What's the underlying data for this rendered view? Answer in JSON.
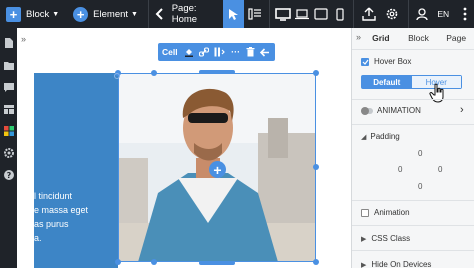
{
  "topbar": {
    "add_label": "Block",
    "element_label": "Element",
    "page_label": "Page: Home",
    "lang": "EN"
  },
  "canvas": {
    "text_lines": [
      "l tincidunt",
      "e massa eget",
      "as purus",
      "a."
    ]
  },
  "toolbar": {
    "cell_label": "Cell"
  },
  "panel": {
    "tabs": [
      "Grid",
      "Block",
      "Page"
    ],
    "hover_box_label": "Hover Box",
    "seg_default": "Default",
    "seg_hover": "Hover",
    "animation_label": "ANIMATION",
    "padding_label": "Padding",
    "padding_values": [
      "0",
      "0",
      "0",
      "0"
    ],
    "animation_check_label": "Animation",
    "css_class_label": "CSS Class",
    "hide_label": "Hide On Devices"
  },
  "colors": {
    "accent": "#4a90e2",
    "dark": "#1f2329",
    "panel": "#f5f6f7"
  }
}
